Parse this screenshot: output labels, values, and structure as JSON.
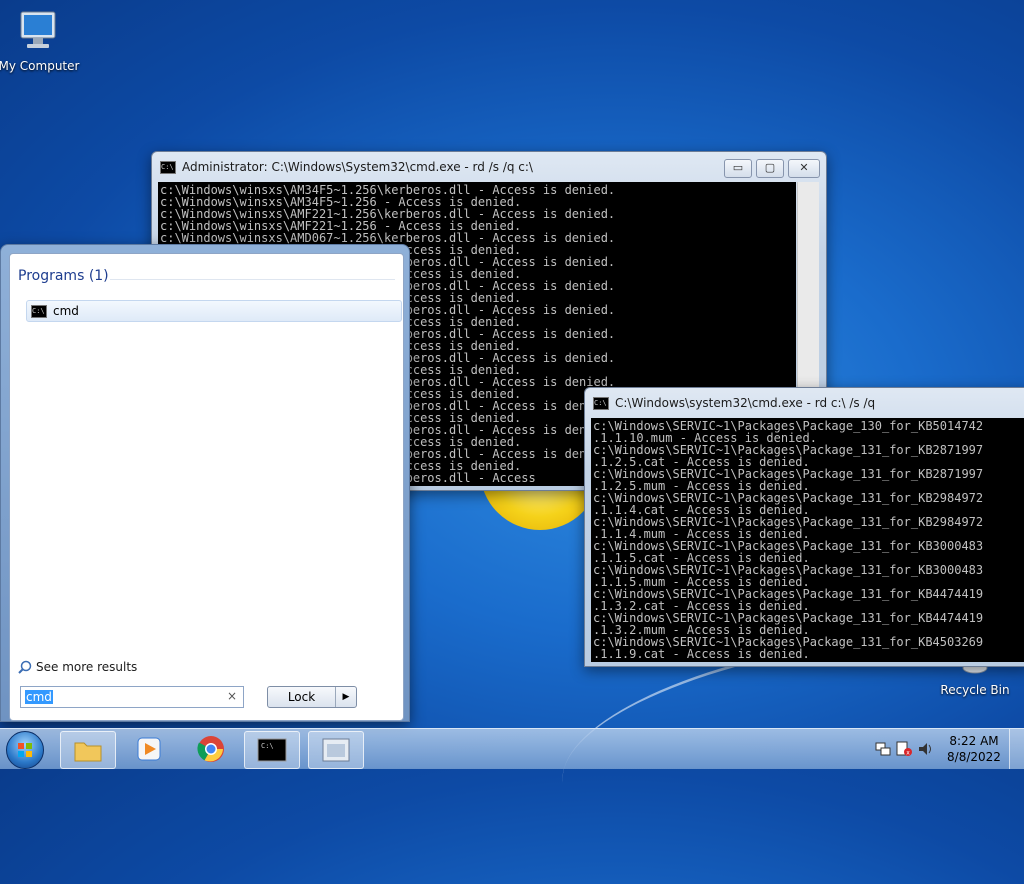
{
  "desktop": {
    "icons": [
      {
        "label": "My Computer"
      },
      {
        "label": "Recycle Bin"
      }
    ]
  },
  "window1": {
    "title": "Administrator: C:\\Windows\\System32\\cmd.exe - rd  /s /q c:\\",
    "lines": [
      "c:\\Windows\\winsxs\\AM34F5~1.256\\kerberos.dll - Access is denied.",
      "c:\\Windows\\winsxs\\AM34F5~1.256 - Access is denied.",
      "c:\\Windows\\winsxs\\AMF221~1.256\\kerberos.dll - Access is denied.",
      "c:\\Windows\\winsxs\\AMF221~1.256 - Access is denied.",
      "c:\\Windows\\winsxs\\AMD067~1.256\\kerberos.dll - Access is denied.",
      "c:\\Windows\\winsxs\\AMD067~1.256 - Access is denied.",
      "c:\\Windows\\winsxs\\AMD06B~1.256\\kerberos.dll - Access is denied.",
      "c:\\Windows\\winsxs\\AMD06B~1.256 - Access is denied.",
      "c:\\Windows\\winsxs\\AMD07F~1.256\\kerberos.dll - Access is denied.",
      "c:\\Windows\\winsxs\\AMD07F~1.256 - Access is denied.",
      "c:\\Windows\\winsxs\\AMD0A2~1.256\\kerberos.dll - Access is denied.",
      "c:\\Windows\\winsxs\\AMD0A2~1.256 - Access is denied.",
      "c:\\Windows\\winsxs\\AMD0C1~1.256\\kerberos.dll - Access is denied.",
      "c:\\Windows\\winsxs\\AMD0C1~1.256 - Access is denied.",
      "c:\\Windows\\winsxs\\AMD0E4~1.256\\kerberos.dll - Access is denied.",
      "c:\\Windows\\winsxs\\AMD0E4~1.256 - Access is denied.",
      "c:\\Windows\\winsxs\\AMD13F~1.256\\kerberos.dll - Access is denied.",
      "c:\\Windows\\winsxs\\AMD13F~1.256 - Access is denied.",
      "c:\\Windows\\winsxs\\AMD152~1.256\\kerberos.dll - Access is denied.",
      "c:\\Windows\\winsxs\\AMD152~1.256 - Access is denied.",
      "c:\\Windows\\winsxs\\AMD1A9~1.256\\kerberos.dll - Access is denied.",
      "c:\\Windows\\winsxs\\AMD1A9~1.256 - Access is denied.",
      "c:\\Windows\\winsxs\\AMD1C3~1.256\\kerberos.dll - Access is denied.",
      "c:\\Windows\\winsxs\\AMD1C3~1.256 - Access is denied.",
      "c:\\Windows\\winsxs\\AMD1F0~1.256\\kerberos.dll - Access"
    ],
    "buttons": {
      "minimize": "▭",
      "maximize": "▢",
      "close": "✕"
    }
  },
  "window2": {
    "title": "C:\\Windows\\system32\\cmd.exe - rd  c:\\ /s /q",
    "lines": [
      "c:\\Windows\\SERVIC~1\\Packages\\Package_130_for_KB5014742",
      ".1.1.10.mum - Access is denied.",
      "c:\\Windows\\SERVIC~1\\Packages\\Package_131_for_KB2871997",
      ".1.2.5.cat - Access is denied.",
      "c:\\Windows\\SERVIC~1\\Packages\\Package_131_for_KB2871997",
      ".1.2.5.mum - Access is denied.",
      "c:\\Windows\\SERVIC~1\\Packages\\Package_131_for_KB2984972",
      ".1.1.4.cat - Access is denied.",
      "c:\\Windows\\SERVIC~1\\Packages\\Package_131_for_KB2984972",
      ".1.1.4.mum - Access is denied.",
      "c:\\Windows\\SERVIC~1\\Packages\\Package_131_for_KB3000483",
      ".1.1.5.cat - Access is denied.",
      "c:\\Windows\\SERVIC~1\\Packages\\Package_131_for_KB3000483",
      ".1.1.5.mum - Access is denied.",
      "c:\\Windows\\SERVIC~1\\Packages\\Package_131_for_KB4474419",
      ".1.3.2.cat - Access is denied.",
      "c:\\Windows\\SERVIC~1\\Packages\\Package_131_for_KB4474419",
      ".1.3.2.mum - Access is denied.",
      "c:\\Windows\\SERVIC~1\\Packages\\Package_131_for_KB4503269",
      ".1.1.9.cat - Access is denied."
    ]
  },
  "startmenu": {
    "programs_header": "Programs (1)",
    "item_label": "cmd",
    "see_more": "See more results",
    "search_value": "cmd",
    "clear": "×",
    "lock_label": "Lock",
    "lock_arrow": "▶"
  },
  "taskbar": {
    "buttons": [
      "start-orb",
      "explorer",
      "media-player",
      "chrome",
      "cmd",
      "window"
    ],
    "clock_time": "8:22 AM",
    "clock_date": "8/8/2022"
  }
}
